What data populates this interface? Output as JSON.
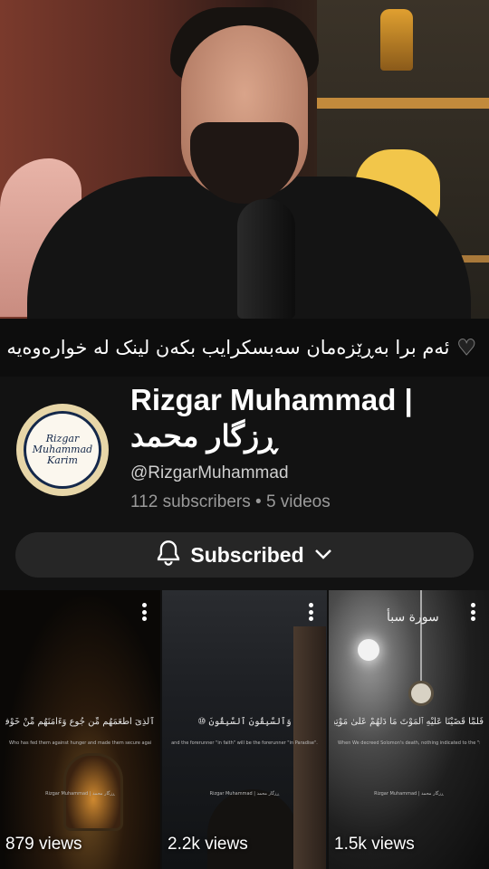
{
  "banner": {
    "text": "ئەم برا بەڕێزەمان سەبسکرایب بکەن لینک لە خوارەوەیە",
    "emoji_icon": "black-heart-icon"
  },
  "channel": {
    "name_latin": "Rizgar Muhammad |",
    "name_kurdish": "ڕزگار محمد",
    "handle": "@RizgarMuhammad",
    "subscribers": "112 subscribers",
    "separator": "•",
    "videos": "5 videos",
    "avatar_text": [
      "Rizgar",
      "Muhammad",
      "Karim"
    ],
    "subscribe_label": "Subscribed"
  },
  "videos": [
    {
      "views": "879 views",
      "caption": "ٱلَّذِىٓ أَطْعَمَهُم مِّن جُوعٍ وَءَامَنَهُم مِّنْ خَوْفٍ ④",
      "translation": "Who has fed them against hunger and made them secure against fear.",
      "credit": "Rizgar Muhammad | ڕزگار محمد"
    },
    {
      "views": "2.2k views",
      "caption": "وَٱلسَّٰبِقُونَ ٱلسَّٰبِقُونَ ⑩",
      "translation": "and the forerunner \"in faith\" will be the forerunner \"in Paradise\".",
      "credit": "Rizgar Muhammad | ڕزگار محمد"
    },
    {
      "views": "1.5k views",
      "surah_title": "سورة سبأ",
      "caption": "فَلَمَّا قَضَيْنَا عَلَيْهِ ٱلْمَوْتَ مَا دَلَّهُمْ عَلَىٰ مَوْتِهِۦٓ",
      "translation": "When We decreed Solomon's death, nothing indicated to the \"subjected\" jinn that he was dead.",
      "credit": "Rizgar Muhammad | ڕزگار محمد"
    }
  ],
  "colors": {
    "background": "#0f0f0f",
    "button_bg": "#262626",
    "secondary_text": "#9a9a9a"
  }
}
